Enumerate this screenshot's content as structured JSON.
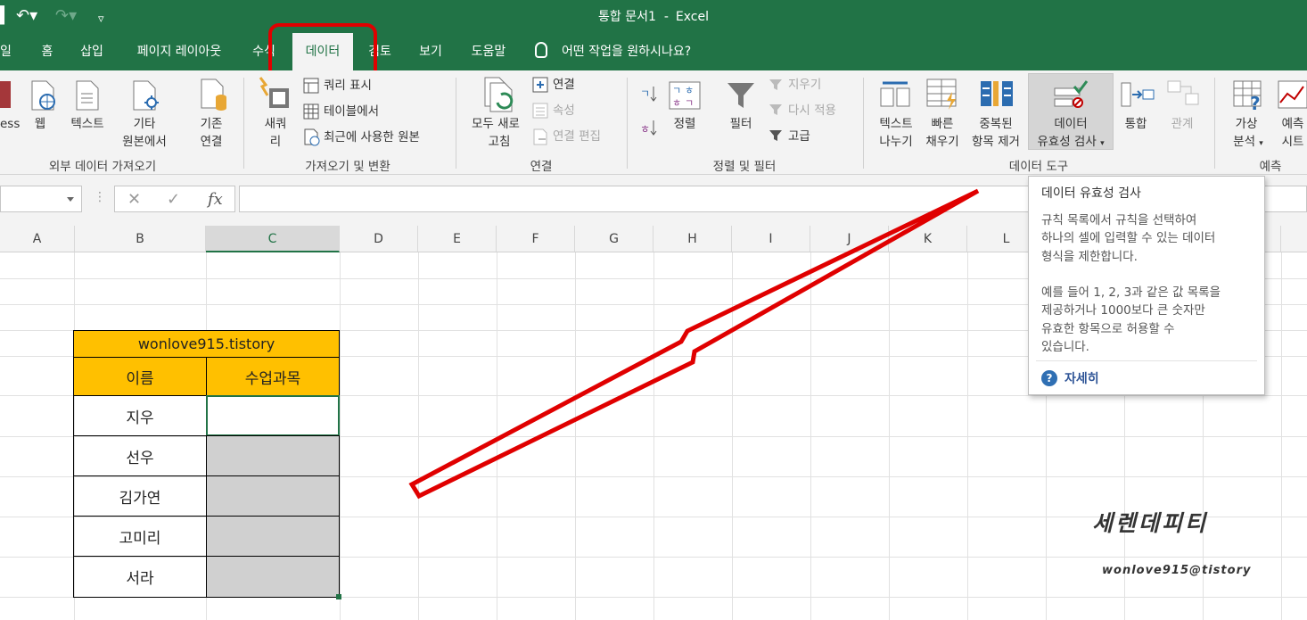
{
  "window": {
    "title": "통합 문서1",
    "app": "Excel"
  },
  "tabs": [
    "일",
    "홈",
    "삽입",
    "페이지 레이아웃",
    "수식",
    "데이터",
    "검토",
    "보기",
    "도움말"
  ],
  "active_tab": "데이터",
  "tell_me": "어떤 작업을 원하시나요?",
  "ribbon": {
    "get_external": {
      "group": "외부 데이터 가져오기",
      "access": "ess",
      "web": "웹",
      "text": "텍스트",
      "other_1": "기타",
      "other_2": "원본에서",
      "existing_1": "기존",
      "existing_2": "연결"
    },
    "get_transform": {
      "group": "가져오기 및 변환",
      "new_query_1": "새쿼",
      "new_query_2": "리",
      "show_query": "쿼리 표시",
      "from_table": "테이블에서",
      "recent_sources": "최근에 사용한 원본"
    },
    "connections": {
      "group": "연결",
      "refresh_1": "모두 새로",
      "refresh_2": "고침",
      "connections": "연결",
      "properties": "속성",
      "edit_links": "연결 편집"
    },
    "sort_filter": {
      "group": "정렬 및 필터",
      "sort": "정렬",
      "filter": "필터",
      "clear": "지우기",
      "reapply": "다시 적용",
      "advanced": "고급"
    },
    "data_tools": {
      "group": "데이터 도구",
      "text_to_columns_1": "텍스트",
      "text_to_columns_2": "나누기",
      "flash_fill_1": "빠른",
      "flash_fill_2": "채우기",
      "remove_dup_1": "중복된",
      "remove_dup_2": "항목 제거",
      "validation_1": "데이터",
      "validation_2": "유효성 검사",
      "consolidate": "통합",
      "relationships": "관계"
    },
    "forecast": {
      "group": "예측",
      "whatif_1": "가상",
      "whatif_2": "분석",
      "sheet_1": "예측",
      "sheet_2": "시트"
    }
  },
  "formula_bar": {
    "fx": "fx"
  },
  "columns": [
    "A",
    "B",
    "C",
    "D",
    "E",
    "F",
    "G",
    "H",
    "I",
    "J",
    "K",
    "L"
  ],
  "table": {
    "site": "wonlove915.tistory",
    "header_name": "이름",
    "header_subject": "수업과목",
    "names": [
      "지우",
      "선우",
      "김가연",
      "고미리",
      "서라"
    ]
  },
  "tooltip": {
    "title": "데이터 유효성 검사",
    "body": "규칙 목록에서 규칙을 선택하여\n하나의 셀에 입력할 수 있는 데이터\n형식을 제한합니다.\n\n예를 들어 1, 2, 3과 같은 값 목록을\n제공하거나 1000보다 큰 숫자만\n유효한 항목으로 허용할 수\n있습니다.",
    "more": "자세히"
  },
  "watermark": {
    "korean": "세렌데피티",
    "english": "wonlove915@tistory"
  },
  "colors": {
    "excel_green": "#217346",
    "header_yellow": "#FFC000",
    "annotation_red": "#E00000"
  }
}
